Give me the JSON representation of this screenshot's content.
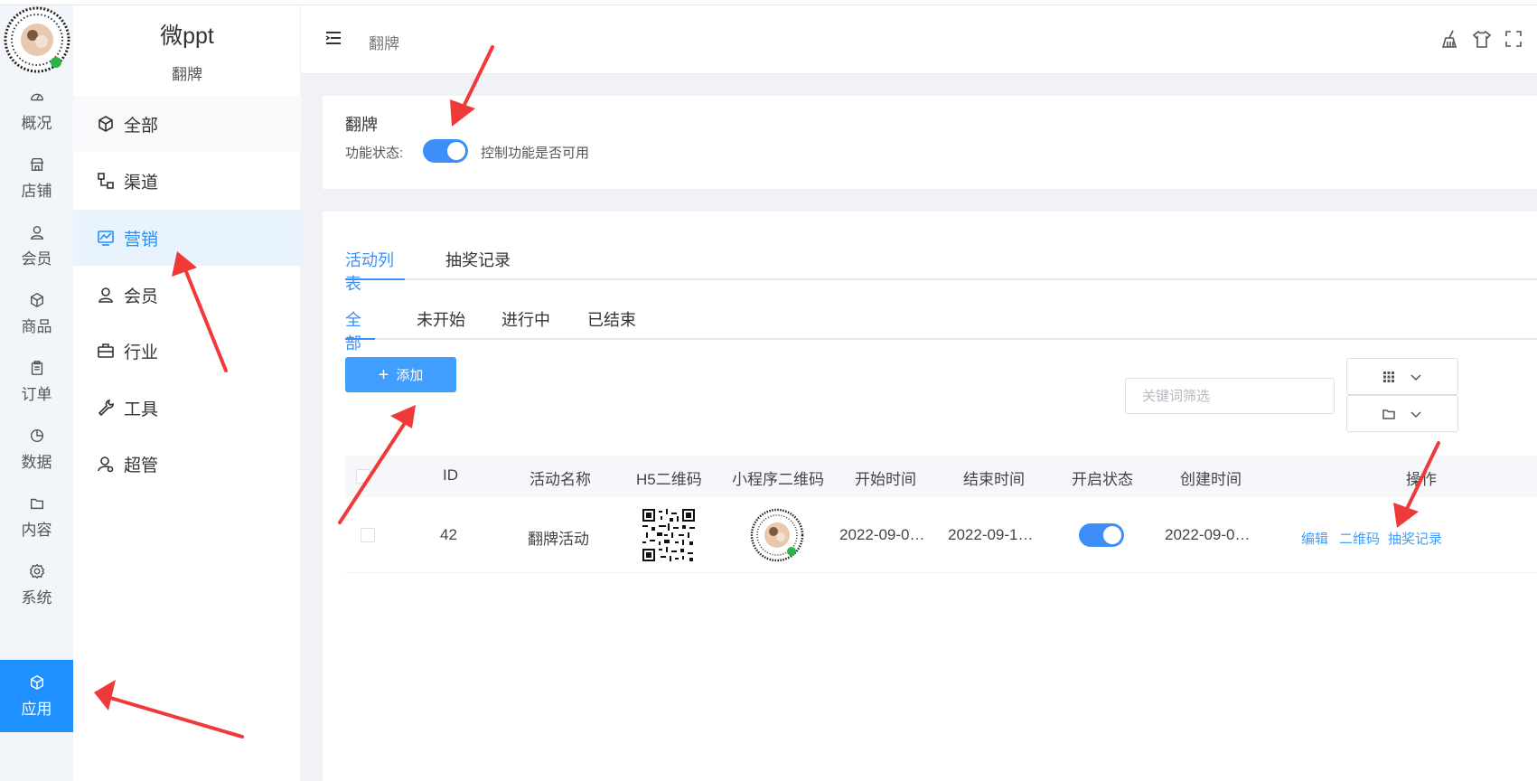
{
  "app": {
    "brand": "微ppt",
    "brand_sub": "翻牌"
  },
  "rail": {
    "items": [
      {
        "label": "概况",
        "icon": "dashboard-icon"
      },
      {
        "label": "店铺",
        "icon": "store-icon"
      },
      {
        "label": "会员",
        "icon": "user-icon"
      },
      {
        "label": "商品",
        "icon": "box-icon"
      },
      {
        "label": "订单",
        "icon": "clipboard-icon"
      },
      {
        "label": "数据",
        "icon": "pie-icon"
      },
      {
        "label": "内容",
        "icon": "folder-icon"
      },
      {
        "label": "系统",
        "icon": "gear-icon"
      },
      {
        "label": "应用",
        "icon": "cube-icon",
        "active": true
      }
    ]
  },
  "submenu": {
    "items": [
      {
        "label": "全部",
        "icon": "cube-icon"
      },
      {
        "label": "渠道",
        "icon": "channel-icon"
      },
      {
        "label": "营销",
        "icon": "chart-icon",
        "active": true
      },
      {
        "label": "会员",
        "icon": "user-icon"
      },
      {
        "label": "行业",
        "icon": "briefcase-icon"
      },
      {
        "label": "工具",
        "icon": "wrench-icon"
      },
      {
        "label": "超管",
        "icon": "admin-icon"
      }
    ]
  },
  "header": {
    "breadcrumb": "翻牌"
  },
  "feature": {
    "title": "翻牌",
    "status_label": "功能状态:",
    "status_on": true,
    "status_desc": "控制功能是否可用"
  },
  "main": {
    "tabs": [
      "活动列表",
      "抽奖记录"
    ],
    "active_tab": 0,
    "filter_tabs": [
      "全部",
      "未开始",
      "进行中",
      "已结束"
    ],
    "active_filter": 0,
    "add_label": "添加",
    "search_placeholder": "关键词筛选"
  },
  "table": {
    "headers": [
      "ID",
      "活动名称",
      "H5二维码",
      "小程序二维码",
      "开始时间",
      "结束时间",
      "开启状态",
      "创建时间",
      "操作"
    ],
    "rows": [
      {
        "id": "42",
        "name": "翻牌活动",
        "start": "2022-09-0…",
        "end": "2022-09-1…",
        "enabled": true,
        "created": "2022-09-0…",
        "actions": [
          "编辑",
          "二维码",
          "抽奖记录"
        ]
      }
    ]
  },
  "colors": {
    "accent": "#409eff",
    "rail_active": "#1e90ff",
    "arrow": "#f03a3a"
  }
}
